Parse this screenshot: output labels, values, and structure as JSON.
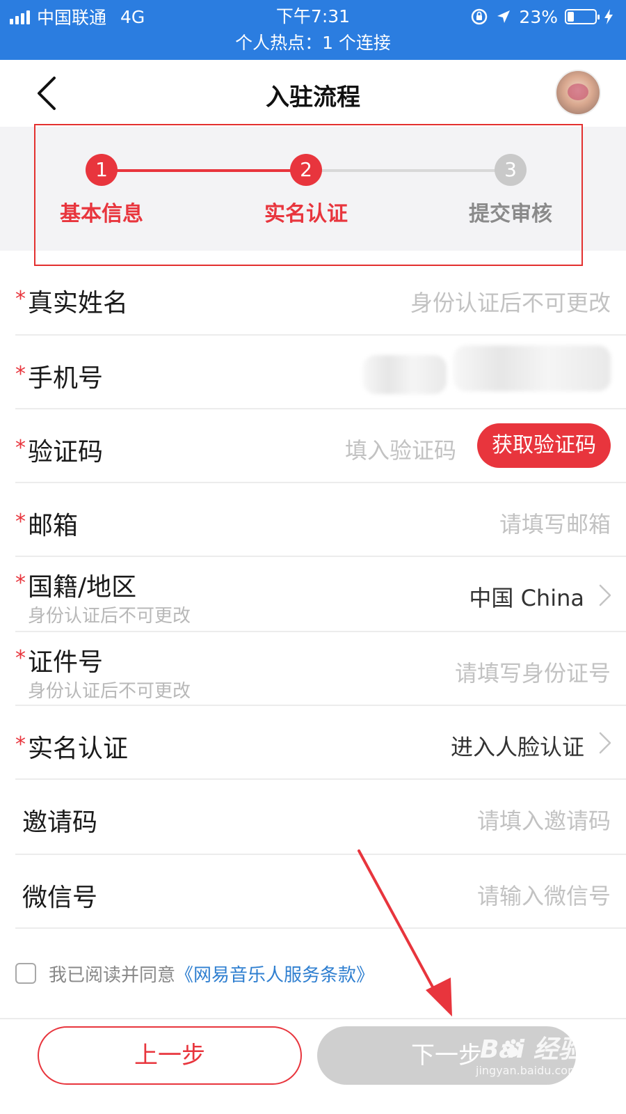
{
  "status_bar": {
    "carrier": "中国联通",
    "network": "4G",
    "time": "下午7:31",
    "battery": "23%",
    "hotspot": "个人热点：1 个连接"
  },
  "nav": {
    "title": "入驻流程",
    "back_icon": "chevron-left-icon",
    "avatar_icon": "avatar"
  },
  "steps": [
    {
      "num": "1",
      "label": "基本信息",
      "state": "done"
    },
    {
      "num": "2",
      "label": "实名认证",
      "state": "active"
    },
    {
      "num": "3",
      "label": "提交审核",
      "state": "pending"
    }
  ],
  "form": {
    "real_name": {
      "label": "真实姓名",
      "placeholder": "身份认证后不可更改"
    },
    "phone": {
      "label": "手机号"
    },
    "code": {
      "label": "验证码",
      "placeholder": "填入验证码",
      "button": "获取验证码"
    },
    "email": {
      "label": "邮箱",
      "placeholder": "请填写邮箱"
    },
    "nationality": {
      "label": "国籍/地区",
      "sublabel": "身份认证后不可更改",
      "value": "中国 China"
    },
    "id_number": {
      "label": "证件号",
      "sublabel": "身份认证后不可更改",
      "placeholder": "请填写身份证号"
    },
    "face_auth": {
      "label": "实名认证",
      "value": "进入人脸认证"
    },
    "invite": {
      "label": "邀请码",
      "placeholder": "请填入邀请码"
    },
    "wechat": {
      "label": "微信号",
      "placeholder": "请输入微信号"
    }
  },
  "required_mark": "*",
  "agreement": {
    "text": "我已阅读并同意",
    "link": "《网易音乐人服务条款》"
  },
  "buttons": {
    "prev": "上一步",
    "next": "下一步"
  },
  "watermark": {
    "brand": "Bai  经验",
    "url": "jingyan.baidu.com"
  },
  "colors": {
    "status_bar": "#2b7de0",
    "accent": "#e8353d",
    "link": "#2f7fd0",
    "disabled": "#cfcfcf"
  }
}
